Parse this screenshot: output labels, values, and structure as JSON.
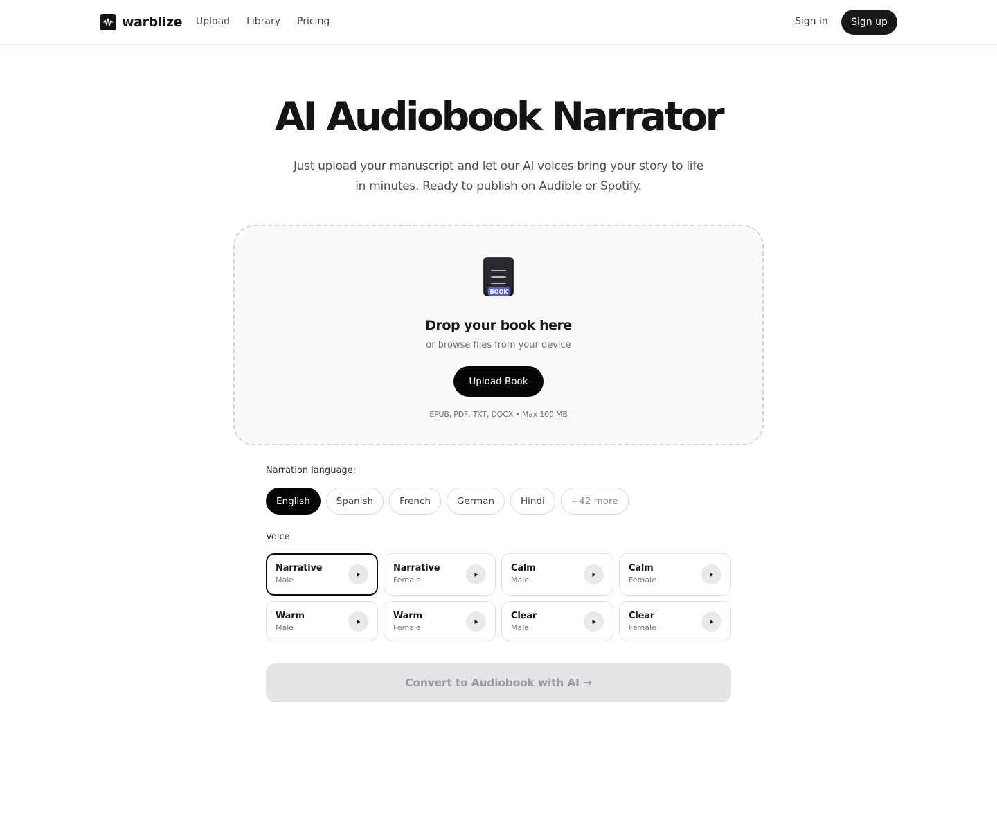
{
  "brand": {
    "name": "warblize"
  },
  "nav": [
    {
      "label": "Upload"
    },
    {
      "label": "Library"
    },
    {
      "label": "Pricing"
    }
  ],
  "auth": {
    "signin_label": "Sign in",
    "signup_label": "Sign up"
  },
  "hero": {
    "title": "AI Audiobook Narrator",
    "subtitle": "Just upload your manuscript and let our AI voices bring your story to life in minutes. Ready to publish on Audible or Spotify."
  },
  "dropzone": {
    "icon_badge": "BOOK",
    "title": "Drop your book here",
    "subtitle": "or browse files from your device",
    "button_label": "Upload Book",
    "formats": "EPUB, PDF, TXT, DOCX • Max 100 MB"
  },
  "language": {
    "label": "Narration language:",
    "options": [
      {
        "label": "English",
        "selected": true
      },
      {
        "label": "Spanish",
        "selected": false
      },
      {
        "label": "French",
        "selected": false
      },
      {
        "label": "German",
        "selected": false
      },
      {
        "label": "Hindi",
        "selected": false
      },
      {
        "label": "+42 more",
        "selected": false
      }
    ]
  },
  "voice": {
    "label": "Voice",
    "options": [
      {
        "name": "Narrative",
        "gender": "Male",
        "selected": true
      },
      {
        "name": "Narrative",
        "gender": "Female",
        "selected": false
      },
      {
        "name": "Calm",
        "gender": "Male",
        "selected": false
      },
      {
        "name": "Calm",
        "gender": "Female",
        "selected": false
      },
      {
        "name": "Warm",
        "gender": "Male",
        "selected": false
      },
      {
        "name": "Warm",
        "gender": "Female",
        "selected": false
      },
      {
        "name": "Clear",
        "gender": "Male",
        "selected": false
      },
      {
        "name": "Clear",
        "gender": "Female",
        "selected": false
      }
    ]
  },
  "convert": {
    "label": "Convert to Audiobook with AI →",
    "enabled": false
  },
  "icons": {
    "logo": "waveform-icon",
    "book": "book-icon",
    "play": "play-icon"
  },
  "colors": {
    "primary": "#050505",
    "badge": "#5b5bd6",
    "disabled_bg": "#e4e4e6",
    "disabled_text": "#9a9aa0"
  }
}
